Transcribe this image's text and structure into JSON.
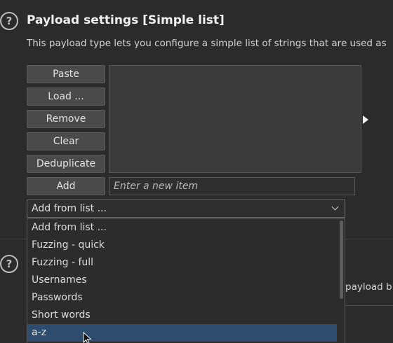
{
  "payload_settings": {
    "title": "Payload settings [Simple list]",
    "description": "This payload type lets you configure a simple list of strings that are used as",
    "help_glyph": "?"
  },
  "buttons": {
    "paste": "Paste",
    "load": "Load ...",
    "remove": "Remove",
    "clear": "Clear",
    "deduplicate": "Deduplicate",
    "add": "Add"
  },
  "new_item": {
    "value": "",
    "placeholder": "Enter a new item"
  },
  "add_from_list": {
    "selected": "Add from list ...",
    "options": [
      "Add from list ...",
      "Fuzzing - quick",
      "Fuzzing - full",
      "Usernames",
      "Passwords",
      "Short words",
      "a-z"
    ],
    "highlighted_index": 6
  },
  "next_section": {
    "help_glyph": "?",
    "partial_text": "payload b"
  },
  "colors": {
    "background": "#2b2b2b",
    "button": "#4a4a4a",
    "highlight": "#2e4d6e"
  }
}
